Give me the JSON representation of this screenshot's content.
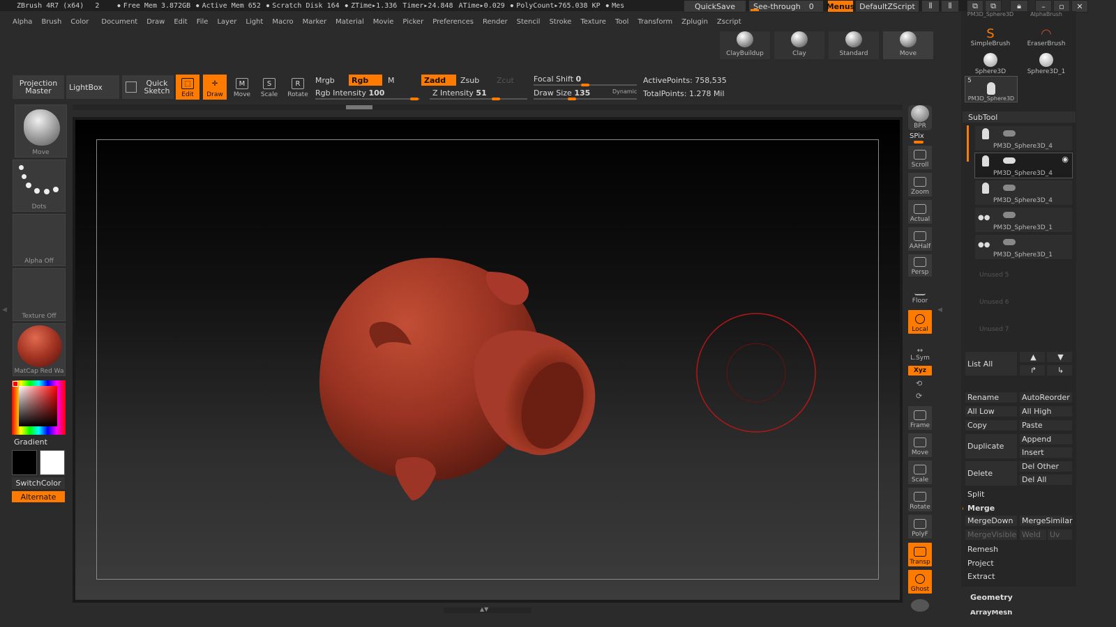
{
  "status": {
    "app_title": "ZBrush 4R7 (x64)",
    "doc_count": "2",
    "free_mem": "Free Mem 3.872GB",
    "active_mem": "Active Mem 652",
    "scratch_disk": "Scratch Disk 164",
    "ztime": "ZTime▸1.336",
    "timer": "Timer▸24.848",
    "atime": "ATime▸0.029",
    "polycount": "PolyCount▸765.038 KP",
    "mesh": "Mes",
    "quicksave": "QuickSave",
    "seethrough": "See-through",
    "seethrough_value": "0",
    "menus": "Menus",
    "script": "DefaultZScript"
  },
  "menubar": [
    "Alpha",
    "Brush",
    "Color",
    "Document",
    "Draw",
    "Edit",
    "File",
    "Layer",
    "Light",
    "Macro",
    "Marker",
    "Material",
    "Movie",
    "Picker",
    "Preferences",
    "Render",
    "Stencil",
    "Stroke",
    "Texture",
    "Tool",
    "Transform",
    "Zplugin",
    "Zscript"
  ],
  "brush_thumbs": [
    "ClayBuildup",
    "Clay",
    "Standard",
    "Move"
  ],
  "toolbar": {
    "projection_master": "Projection Master",
    "lightbox": "LightBox",
    "quick_sketch": "Quick Sketch",
    "edit": "Edit",
    "draw": "Draw",
    "move": "Move",
    "scale": "Scale",
    "rotate": "Rotate",
    "mrgb": "Mrgb",
    "rgb": "Rgb",
    "m": "M",
    "zadd": "Zadd",
    "zsub": "Zsub",
    "zcut": "Zcut",
    "rgb_intensity_label": "Rgb Intensity",
    "rgb_intensity": "100",
    "z_intensity_label": "Z Intensity",
    "z_intensity": "51",
    "focal_shift_label": "Focal Shift",
    "focal_shift": "0",
    "draw_size_label": "Draw Size",
    "draw_size": "135",
    "dynamic": "Dynamic",
    "active_points_label": "ActivePoints:",
    "active_points": "758,535",
    "total_points_label": "TotalPoints:",
    "total_points": "1.278 Mil"
  },
  "left_shelf": {
    "brush": "Move",
    "stroke": "Dots",
    "alpha": "Alpha Off",
    "texture": "Texture Off",
    "material": "MatCap Red Wa",
    "gradient": "Gradient",
    "switchcolor": "SwitchColor",
    "alternate": "Alternate"
  },
  "right_shelf": [
    "BPR",
    "SPix",
    "Scroll",
    "Zoom",
    "Actual",
    "AAHalf",
    "Persp",
    "Floor",
    "Local",
    "L.Sym",
    "Xyz",
    "Frame",
    "Move",
    "Scale",
    "Rotate",
    "PolyF",
    "Transp",
    "Ghost"
  ],
  "tool_palette": {
    "thumbs": [
      "PM3D_Sphere3D",
      "AlphaBrush",
      "SimpleBrush",
      "EraserBrush",
      "Sphere3D",
      "Sphere3D_1",
      "PM3D_Sphere3D"
    ],
    "tool_count": "5",
    "subtool_title": "SubTool",
    "subtools": [
      "PM3D_Sphere3D_4",
      "PM3D_Sphere3D_4",
      "PM3D_Sphere3D_4",
      "PM3D_Sphere3D_1",
      "PM3D_Sphere3D_1"
    ],
    "unused": [
      "Unused 5",
      "Unused 6",
      "Unused 7"
    ],
    "list_all": "List All",
    "rename": "Rename",
    "autoreorder": "AutoReorder",
    "all_low": "All Low",
    "all_high": "All High",
    "copy": "Copy",
    "paste": "Paste",
    "duplicate": "Duplicate",
    "append": "Append",
    "insert": "Insert",
    "delete": "Delete",
    "del_other": "Del Other",
    "del_all": "Del All",
    "split": "Split",
    "merge": "Merge",
    "mergedown": "MergeDown",
    "mergesimilar": "MergeSimilar",
    "mergevisible": "MergeVisible",
    "weld": "Weld",
    "uv": "Uv",
    "remesh": "Remesh",
    "project": "Project",
    "extract": "Extract",
    "geometry": "Geometry",
    "arraymesh": "ArrayMesh"
  },
  "colors": {
    "accent": "#ff7b00",
    "model": "#9a3322",
    "brush_ring": "#b01818"
  }
}
